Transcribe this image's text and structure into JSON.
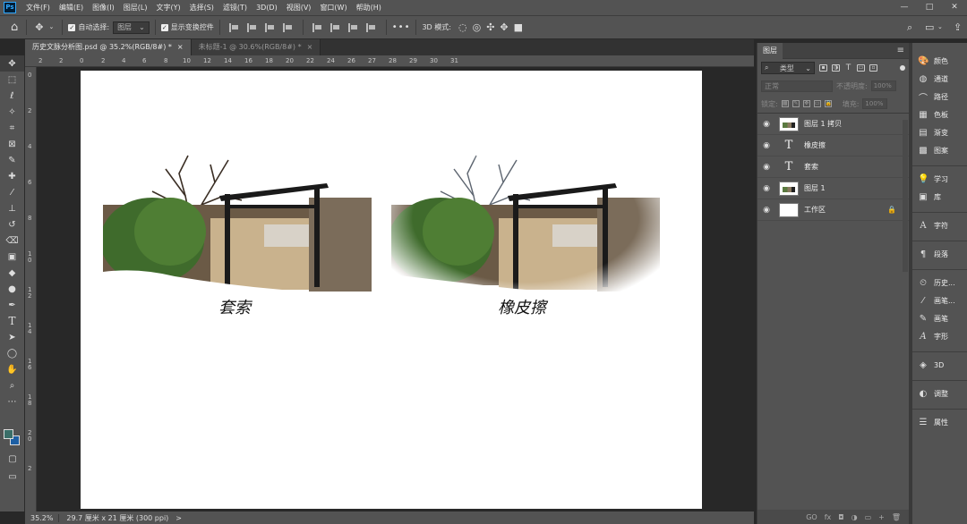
{
  "menubar": {
    "app_icon": "Ps",
    "items": [
      "文件(F)",
      "编辑(E)",
      "图像(I)",
      "图层(L)",
      "文字(Y)",
      "选择(S)",
      "滤镜(T)",
      "3D(D)",
      "视图(V)",
      "窗口(W)",
      "帮助(H)"
    ],
    "window_controls": [
      "—",
      "□",
      "✕"
    ]
  },
  "options": {
    "auto_select_label": "自动选择:",
    "auto_select_value": "图层",
    "show_transform_label": "显示变换控件",
    "more": "•••",
    "mode_label": "3D 模式:"
  },
  "tabs": [
    {
      "label": "历史文脉分析图.psd @ 35.2%(RGB/8#) *",
      "close": "×"
    },
    {
      "label": "未标题-1 @ 30.6%(RGB/8#) *",
      "close": "×"
    }
  ],
  "ruler": {
    "top_ticks": [
      "2",
      "2",
      "0",
      "2",
      "4",
      "6",
      "8",
      "10",
      "12",
      "14",
      "16",
      "18",
      "20",
      "22",
      "24",
      "26",
      "27",
      "28",
      "29",
      "30",
      "31"
    ],
    "left_ticks": [
      "0",
      "2",
      "4",
      "6",
      "8",
      "1 0",
      "1 2",
      "1 4",
      "1 6",
      "1 8",
      "2 0",
      "2"
    ]
  },
  "document": {
    "caption_left": "套索",
    "caption_right": "橡皮擦"
  },
  "status": {
    "zoom": "35.2%",
    "doc_info": "29.7 厘米 x 21 厘米 (300 ppi)",
    "arrow": ">"
  },
  "layers_panel": {
    "title": "图层",
    "filter_value": "类型",
    "blend_mode": "正常",
    "opacity_label": "不透明度:",
    "opacity_value": "100%",
    "lock_label": "锁定:",
    "fill_label": "填充:",
    "fill_value": "100%",
    "layers": [
      {
        "name": "图层 1 拷贝",
        "thumb": "image"
      },
      {
        "name": "橡皮擦",
        "thumb": "text"
      },
      {
        "name": "套索",
        "thumb": "text"
      },
      {
        "name": "图层 1",
        "thumb": "image"
      },
      {
        "name": "工作区",
        "thumb": "white",
        "locked": true
      }
    ],
    "text_thumb_glyph": "T",
    "eye_glyph": "◉",
    "footer_icons": [
      "GO",
      "fx",
      "◘",
      "◑",
      "▭",
      "+",
      "🗑"
    ]
  },
  "dock": {
    "groups": [
      [
        {
          "icon": "palette-icon",
          "label": "颜色"
        },
        {
          "icon": "channels-icon",
          "label": "通道"
        },
        {
          "icon": "paths-icon",
          "label": "路径"
        },
        {
          "icon": "swatches-icon",
          "label": "色板"
        },
        {
          "icon": "gradient-icon",
          "label": "渐变"
        },
        {
          "icon": "patterns-icon",
          "label": "图案"
        }
      ],
      [
        {
          "icon": "learn-icon",
          "label": "学习"
        },
        {
          "icon": "library-icon",
          "label": "库"
        }
      ],
      [
        {
          "icon": "character-icon",
          "label": "字符"
        }
      ],
      [
        {
          "icon": "paragraph-icon",
          "label": "段落"
        }
      ],
      [
        {
          "icon": "history-icon",
          "label": "历史..."
        },
        {
          "icon": "brush-settings-icon",
          "label": "画笔..."
        },
        {
          "icon": "brushes-icon",
          "label": "画笔"
        },
        {
          "icon": "glyphs-icon",
          "label": "字形"
        }
      ],
      [
        {
          "icon": "3d-icon",
          "label": "3D"
        }
      ],
      [
        {
          "icon": "adjustments-icon",
          "label": "调整"
        }
      ],
      [
        {
          "icon": "properties-icon",
          "label": "属性"
        }
      ]
    ]
  },
  "colors": {
    "foreground": "#3a6e68",
    "background": "#1d5fa4",
    "ui_bg": "#535353",
    "canvas_bg": "#282828"
  }
}
